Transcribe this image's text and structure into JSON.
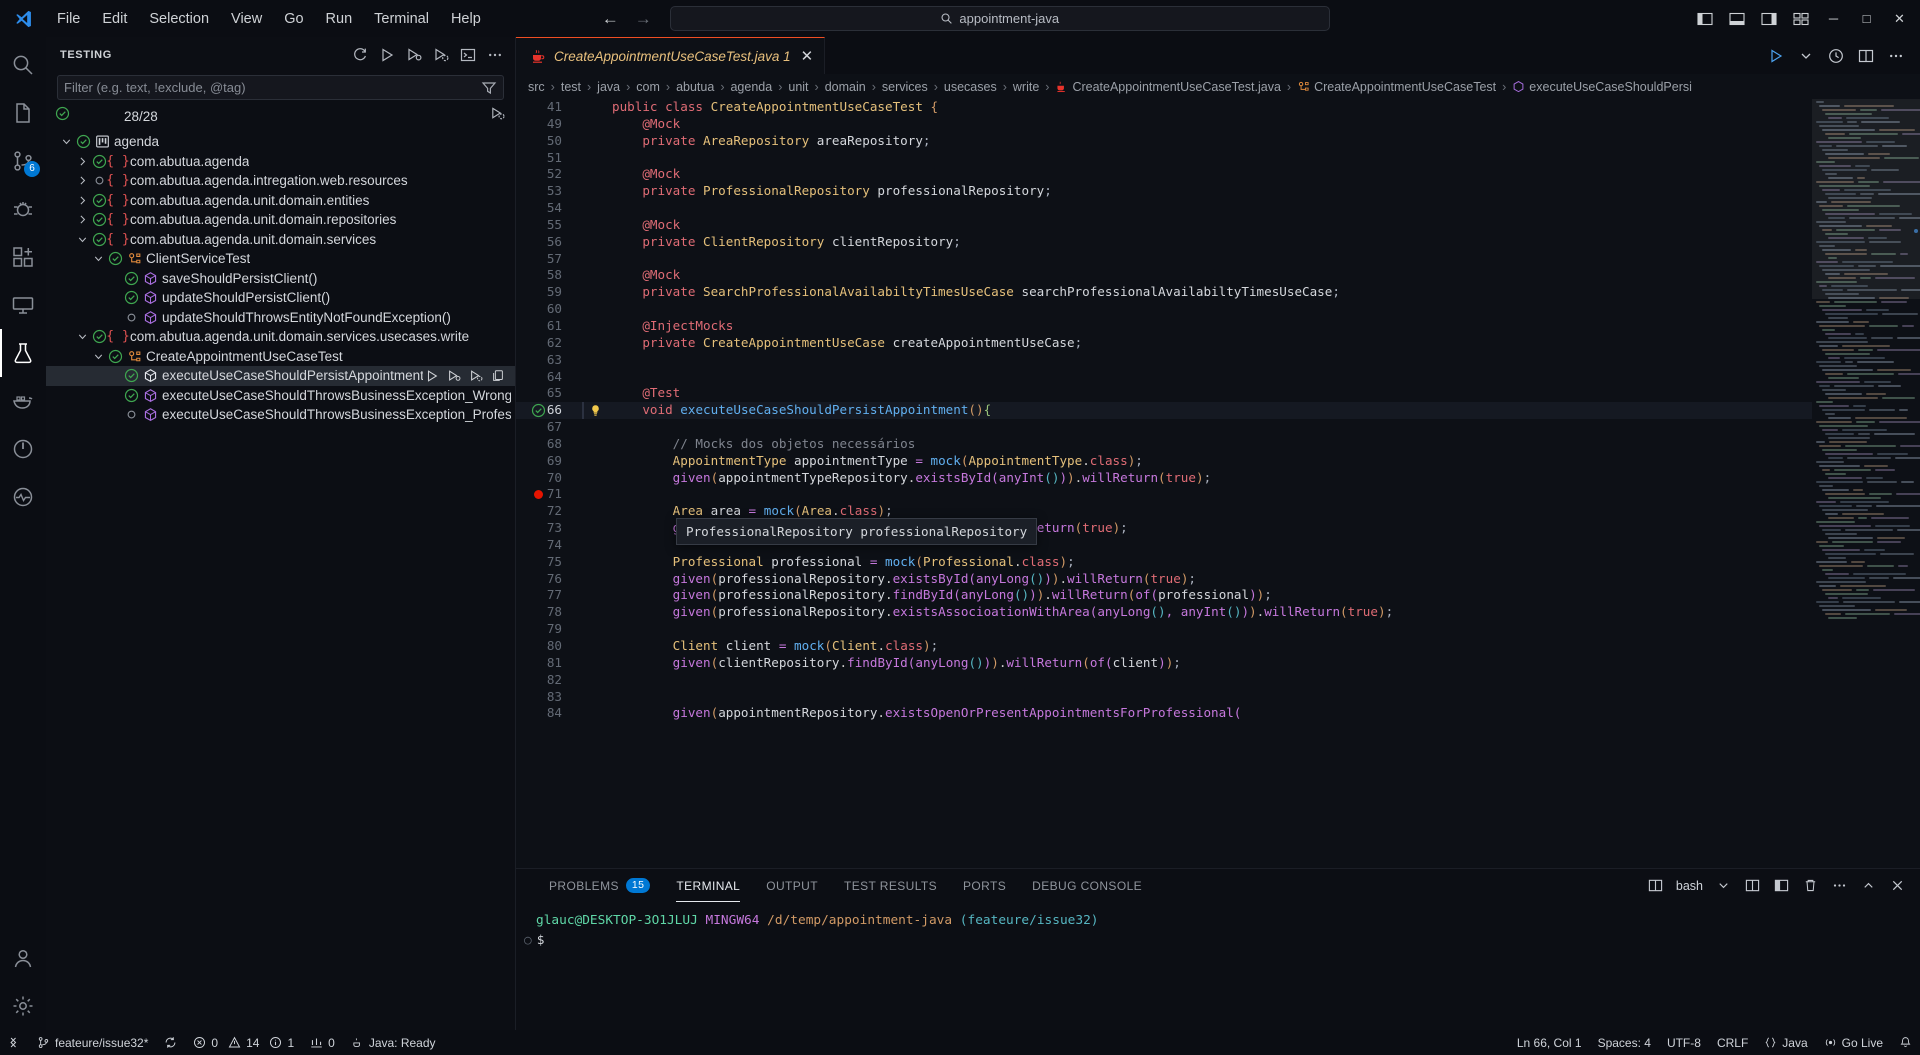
{
  "titlebar": {
    "menus": [
      "File",
      "Edit",
      "Selection",
      "View",
      "Go",
      "Run",
      "Terminal",
      "Help"
    ],
    "search_value": "appointment-java",
    "nav_back": "←",
    "nav_forward": "→",
    "window_minimize": "─",
    "window_maximize": "□",
    "window_close": "✕"
  },
  "activitybar": {
    "items": [
      {
        "name": "search",
        "icon": "search-icon"
      },
      {
        "name": "explorer",
        "icon": "files-icon"
      },
      {
        "name": "source-control",
        "icon": "source-control-icon",
        "badge": "6"
      },
      {
        "name": "run-and-debug",
        "icon": "debug-icon"
      },
      {
        "name": "extensions",
        "icon": "extensions-icon"
      },
      {
        "name": "remote-explorer",
        "icon": "remote-icon"
      },
      {
        "name": "testing",
        "icon": "beaker-icon",
        "active": true
      },
      {
        "name": "docker",
        "icon": "docker-icon"
      },
      {
        "name": "power",
        "icon": "power-icon"
      },
      {
        "name": "health",
        "icon": "health-icon"
      }
    ],
    "bottom": [
      {
        "name": "accounts",
        "icon": "account-icon"
      },
      {
        "name": "settings",
        "icon": "gear-icon"
      }
    ]
  },
  "sidebar": {
    "title": "TESTING",
    "actions": [
      "refresh-tests-icon",
      "run-all-tests-icon",
      "debug-all-tests-icon",
      "coverage-icon",
      "show-output-icon",
      "more-actions-icon"
    ],
    "filter_placeholder": "Filter (e.g. text, !exclude, @tag)",
    "filter_value": "",
    "summary": "28/28",
    "tree": [
      {
        "indent": 0,
        "twisty": "down",
        "state": "pass",
        "icon": "project-icon",
        "label": "agenda"
      },
      {
        "indent": 1,
        "twisty": "right",
        "state": "pass",
        "icon": "package-icon",
        "label": "com.abutua.agenda"
      },
      {
        "indent": 1,
        "twisty": "right",
        "state": "notrun",
        "icon": "package-icon",
        "label": "com.abutua.agenda.intregation.web.resources"
      },
      {
        "indent": 1,
        "twisty": "right",
        "state": "pass",
        "icon": "package-icon",
        "label": "com.abutua.agenda.unit.domain.entities"
      },
      {
        "indent": 1,
        "twisty": "right",
        "state": "pass",
        "icon": "package-icon",
        "label": "com.abutua.agenda.unit.domain.repositories"
      },
      {
        "indent": 1,
        "twisty": "down",
        "state": "pass",
        "icon": "package-icon",
        "label": "com.abutua.agenda.unit.domain.services"
      },
      {
        "indent": 2,
        "twisty": "down",
        "state": "pass",
        "icon": "class-icon",
        "label": "ClientServiceTest"
      },
      {
        "indent": 3,
        "twisty": "none",
        "state": "pass",
        "icon": "method-icon",
        "label": "saveShouldPersistClient()"
      },
      {
        "indent": 3,
        "twisty": "none",
        "state": "pass",
        "icon": "method-icon",
        "label": "updateShouldPersistClient()"
      },
      {
        "indent": 3,
        "twisty": "none",
        "state": "notrun",
        "icon": "method-icon",
        "label": "updateShouldThrowsEntityNotFoundException()"
      },
      {
        "indent": 1,
        "twisty": "down",
        "state": "pass",
        "icon": "package-icon",
        "label": "com.abutua.agenda.unit.domain.services.usecases.write"
      },
      {
        "indent": 2,
        "twisty": "down",
        "state": "pass",
        "icon": "class-icon",
        "label": "CreateAppointmentUseCaseTest"
      },
      {
        "indent": 3,
        "twisty": "none",
        "state": "pass",
        "icon": "method-icon-mono",
        "label": "executeUseCaseShouldPersistAppointment()",
        "selected": true,
        "actions": [
          "run-test-icon",
          "debug-test-icon",
          "run-with-coverage-icon",
          "more-icon"
        ]
      },
      {
        "indent": 3,
        "twisty": "none",
        "state": "pass",
        "icon": "method-icon",
        "label": "executeUseCaseShouldThrowsBusinessException_WrongStartAndEndTime()"
      },
      {
        "indent": 3,
        "twisty": "none",
        "state": "notrun",
        "icon": "method-icon",
        "label": "executeUseCaseShouldThrowsBusinessException_ProfessionalNotAvailable()"
      }
    ]
  },
  "editor": {
    "tab": {
      "label": "CreateAppointmentUseCaseTest.java 1",
      "icon": "java-file-icon",
      "close": "✕"
    },
    "tab_actions": [
      "run-icon",
      "split-editor-icon",
      "timeline-icon",
      "open-changes-icon",
      "more-actions-icon"
    ],
    "breadcrumbs": [
      {
        "label": "src"
      },
      {
        "label": "test"
      },
      {
        "label": "java"
      },
      {
        "label": "com"
      },
      {
        "label": "abutua"
      },
      {
        "label": "agenda"
      },
      {
        "label": "unit"
      },
      {
        "label": "domain"
      },
      {
        "label": "services"
      },
      {
        "label": "usecases"
      },
      {
        "label": "write"
      },
      {
        "label": "CreateAppointmentUseCaseTest.java",
        "icon": "java-file-icon"
      },
      {
        "label": "CreateAppointmentUseCaseTest",
        "icon": "class-icon"
      },
      {
        "label": "executeUseCaseShouldPersi",
        "icon": "method-icon"
      }
    ],
    "tooltip": "ProfessionalRepository professionalRepository",
    "lines": [
      {
        "n": 41,
        "html": "<span class='k'>public</span> <span class='k'>class</span> <span class='ty'>CreateAppointmentUseCaseTest</span> <span class='br'>{</span>"
      },
      {
        "n": 49,
        "html": "    <span class='an'>@Mock</span>"
      },
      {
        "n": 50,
        "html": "    <span class='k'>private</span> <span class='ty'>AreaRepository</span> <span class='id'>areaRepository</span><span class='op'>;</span>"
      },
      {
        "n": 51,
        "html": ""
      },
      {
        "n": 52,
        "html": "    <span class='an'>@Mock</span>"
      },
      {
        "n": 53,
        "html": "    <span class='k'>private</span> <span class='ty'>ProfessionalRepository</span> <span class='id'>professionalRepository</span><span class='op'>;</span>"
      },
      {
        "n": 54,
        "html": ""
      },
      {
        "n": 55,
        "html": "    <span class='an'>@Mock</span>"
      },
      {
        "n": 56,
        "html": "    <span class='k'>private</span> <span class='ty'>ClientRepository</span> <span class='id'>clientRepository</span><span class='op'>;</span>"
      },
      {
        "n": 57,
        "html": ""
      },
      {
        "n": 58,
        "html": "    <span class='an'>@Mock</span>"
      },
      {
        "n": 59,
        "html": "    <span class='k'>private</span> <span class='ty'>SearchProfessionalAvailabiltyTimesUseCase</span> <span class='id'>searchProfessionalAvailabiltyTimesUseCase</span><span class='op'>;</span>"
      },
      {
        "n": 60,
        "html": ""
      },
      {
        "n": 61,
        "html": "    <span class='an'>@InjectMocks</span>"
      },
      {
        "n": 62,
        "html": "    <span class='k'>private</span> <span class='ty'>CreateAppointmentUseCase</span> <span class='id'>createAppointmentUseCase</span><span class='op'>;</span>"
      },
      {
        "n": 63,
        "html": ""
      },
      {
        "n": 64,
        "html": ""
      },
      {
        "n": 65,
        "html": "    <span class='an'>@Test</span>"
      },
      {
        "n": 66,
        "html": "    <span class='k'>void</span> <span class='fn'>executeUseCaseShouldPersistAppointment</span><span class='br'>()</span><span class='g'>{</span>",
        "current": true,
        "lamp": true,
        "teststate": "pass"
      },
      {
        "n": 67,
        "html": ""
      },
      {
        "n": 68,
        "html": "        <span class='cm'>// Mocks dos objetos necessários</span>"
      },
      {
        "n": 69,
        "html": "        <span class='ty'>AppointmentType</span> <span class='id'>appointmentType</span> <span class='pu'>=</span> <span class='fn'>mock</span><span class='br'>(</span><span class='ty'>AppointmentType</span>.<span class='k'>class</span><span class='br'>)</span><span class='op'>;</span>"
      },
      {
        "n": 70,
        "html": "        <span class='pu'>given</span><span class='br'>(</span><span class='id'>appointmentTypeRepository</span>.<span class='pu'>existsById</span><span class='br2'>(</span><span class='pu'>anyInt</span><span class='br3'>()</span><span class='br2'>)</span><span class='br'>)</span>.<span class='pu'>willReturn</span><span class='br'>(</span><span class='k'>true</span><span class='br'>)</span><span class='op'>;</span>"
      },
      {
        "n": 71,
        "html": "",
        "breakpoint": true
      },
      {
        "n": 72,
        "html": "        <span class='ty'>Area</span> <span class='id'>area</span> <span class='pu'>=</span> <span class='fn'>mock</span><span class='br'>(</span><span class='ty'>Area</span>.<span class='k'>class</span><span class='br'>)</span><span class='op'>;</span>"
      },
      {
        "n": 73,
        "html": "        <span class='pu'>given</span><span class='br'>(</span><span class='id'>areaRepository</span>.<span class='pu'>existsById</span><span class='br2'>(</span><span class='pu'>anyInt</span><span class='br3'>()</span><span class='br2'>)</span><span class='br'>)</span>.<span class='pu'>willReturn</span><span class='br'>(</span><span class='k'>true</span><span class='br'>)</span><span class='op'>;</span>"
      },
      {
        "n": 74,
        "html": ""
      },
      {
        "n": 75,
        "html": "        <span class='ty'>Professional</span> <span class='id'>professional</span> <span class='pu'>=</span> <span class='fn'>mock</span><span class='br'>(</span><span class='ty'>Professional</span>.<span class='k'>class</span><span class='br'>)</span><span class='op'>;</span>"
      },
      {
        "n": 76,
        "html": "        <span class='pu'>given</span><span class='br'>(</span><span class='id'>professionalRepository</span>.<span class='pu'>existsById</span><span class='br2'>(</span><span class='pu'>anyLong</span><span class='br3'>()</span><span class='br2'>)</span><span class='br'>)</span>.<span class='pu'>willReturn</span><span class='br'>(</span><span class='k'>true</span><span class='br'>)</span><span class='op'>;</span>"
      },
      {
        "n": 77,
        "html": "        <span class='pu'>given</span><span class='br'>(</span><span class='id'>professionalRepository</span>.<span class='pu'>findById</span><span class='br2'>(</span><span class='pu'>anyLong</span><span class='br3'>()</span><span class='br2'>)</span><span class='br'>)</span>.<span class='pu'>willReturn</span><span class='br'>(</span><span class='pu'>of</span><span class='br2'>(</span><span class='id'>professional</span><span class='br2'>)</span><span class='br'>)</span><span class='op'>;</span>"
      },
      {
        "n": 78,
        "html": "        <span class='pu'>given</span><span class='br'>(</span><span class='id'>professionalRepository</span>.<span class='pu'>existsAssocioationWithArea</span><span class='br2'>(</span><span class='pu'>anyLong</span><span class='br3'>()</span><span class='br2'>,</span> <span class='pu'>anyInt</span><span class='br3'>()</span><span class='br2'>)</span><span class='br'>)</span>.<span class='pu'>willReturn</span><span class='br'>(</span><span class='k'>true</span><span class='br'>)</span><span class='op'>;</span>"
      },
      {
        "n": 79,
        "html": ""
      },
      {
        "n": 80,
        "html": "        <span class='ty'>Client</span> <span class='id'>client</span> <span class='pu'>=</span> <span class='fn'>mock</span><span class='br'>(</span><span class='ty'>Client</span>.<span class='k'>class</span><span class='br'>)</span><span class='op'>;</span>"
      },
      {
        "n": 81,
        "html": "        <span class='pu'>given</span><span class='br'>(</span><span class='id'>clientRepository</span>.<span class='pu'>findById</span><span class='br2'>(</span><span class='pu'>anyLong</span><span class='br3'>()</span><span class='br2'>)</span><span class='br'>)</span>.<span class='pu'>willReturn</span><span class='br'>(</span><span class='pu'>of</span><span class='br2'>(</span><span class='id'>client</span><span class='br2'>)</span><span class='br'>)</span><span class='op'>;</span>"
      },
      {
        "n": 82,
        "html": ""
      },
      {
        "n": 83,
        "html": ""
      },
      {
        "n": 84,
        "html": "        <span class='pu'>given</span><span class='br'>(</span><span class='id'>appointmentRepository</span>.<span class='pu'>existsOpenOrPresentAppointmentsForProfessional</span><span class='br2'>(</span>"
      }
    ]
  },
  "panel": {
    "tabs": [
      {
        "label": "PROBLEMS",
        "badge": "15"
      },
      {
        "label": "TERMINAL",
        "active": true
      },
      {
        "label": "OUTPUT"
      },
      {
        "label": "TEST RESULTS"
      },
      {
        "label": "PORTS"
      },
      {
        "label": "DEBUG CONSOLE"
      }
    ],
    "actions": [
      "split-terminal-icon",
      "bash-label",
      "chevron-down-icon",
      "layout-icon",
      "maximize-panel-icon",
      "clear-icon",
      "kill-terminal-icon",
      "more-actions-icon",
      "chevron-up-icon",
      "close-panel-icon"
    ],
    "shell_label": "bash",
    "terminal": {
      "user": "glauc@DESKTOP-3O1JLUJ",
      "shell": "MINGW64",
      "path": "/d/temp/appointment-java",
      "branch": "(feateure/issue32)",
      "prompt": "$"
    }
  },
  "statusbar": {
    "remote": "remote-icon",
    "branch": "feateure/issue32*",
    "sync": "sync-icon",
    "errors": "0",
    "warnings": "14",
    "infos": "1",
    "ports": "0",
    "java_status": "Java: Ready",
    "position": "Ln 66, Col 1",
    "spaces": "Spaces: 4",
    "encoding": "UTF-8",
    "eol": "CRLF",
    "language": "Java",
    "golive": "Go Live",
    "bell": "bell-icon"
  }
}
